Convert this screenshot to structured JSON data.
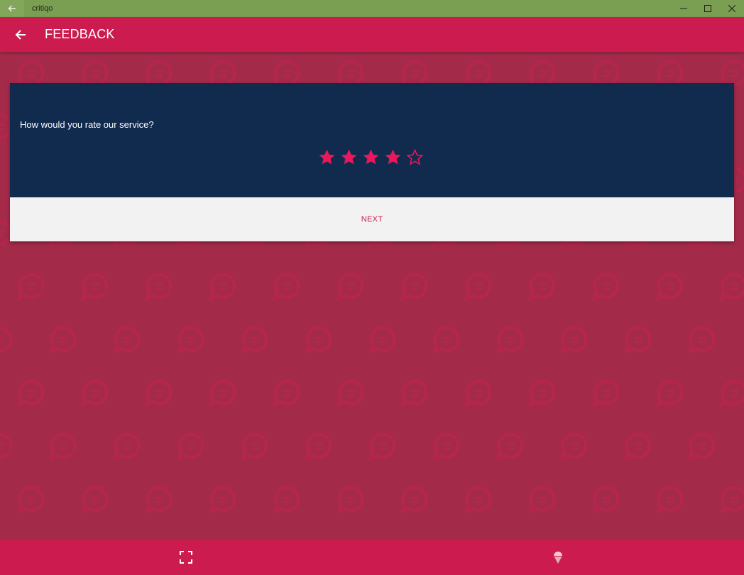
{
  "window": {
    "title": "critiqo",
    "back_icon": "arrow-left-icon",
    "controls": [
      "minimize-icon",
      "maximize-icon",
      "close-icon"
    ]
  },
  "appbar": {
    "title": "FEEDBACK",
    "back_icon": "arrow-left-icon"
  },
  "card": {
    "question": "How would you rate our service?",
    "rating": {
      "value": 4,
      "max": 5
    },
    "next_label": "NEXT"
  },
  "bottombar": {
    "left_icon": "fullscreen-icon",
    "right_icon": "ice-cream-icon"
  },
  "colors": {
    "accent": "#cc1c4f",
    "card_dark": "#112b4f",
    "background": "#a42a4a",
    "titlebar": "#7a9e52",
    "star": "#e8185a"
  }
}
